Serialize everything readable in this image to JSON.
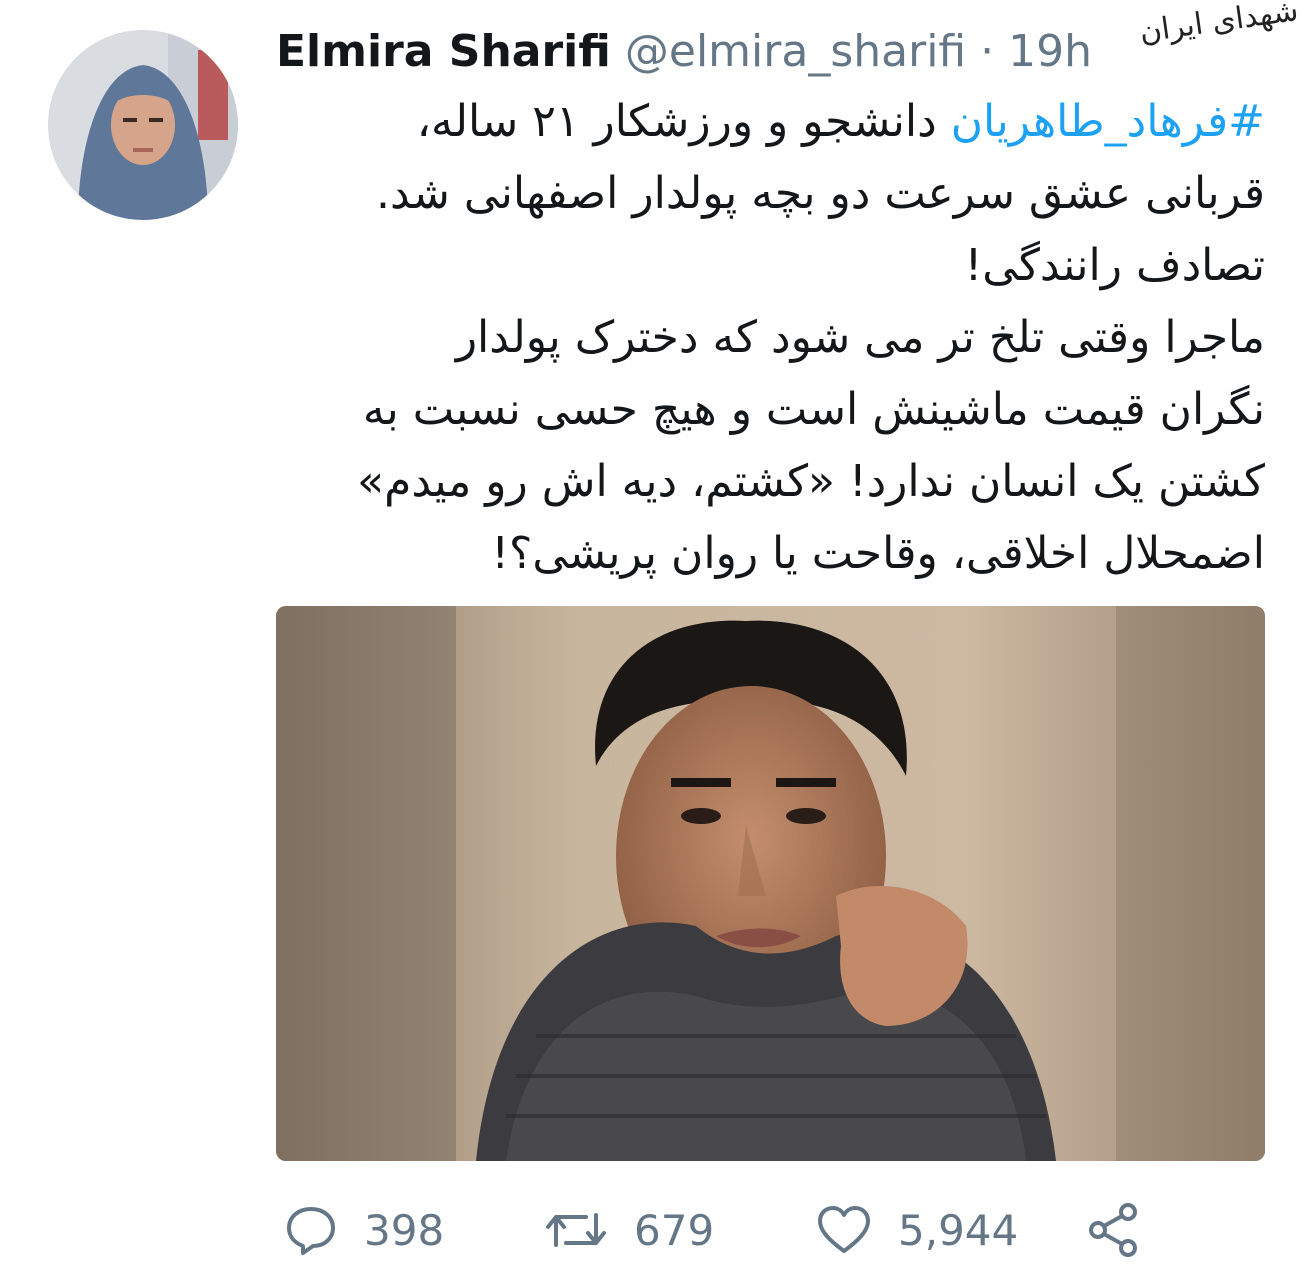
{
  "tweet": {
    "author_name": "Elmira Sharifi",
    "author_handle": "@elmira_sharifi",
    "separator": "·",
    "time": "19h",
    "hashtag": "#فرهاد_طاهریان",
    "lines": [
      " دانشجو و ورزشکار ۲۱ ساله،",
      "قربانی عشق سرعت دو بچه پولدار اصفهانی شد.",
      "تصادف رانندگی!",
      "ماجرا وقتی تلخ تر می شود که دخترک پولدار",
      "نگران قیمت ماشینش است و هیچ حسی نسبت به",
      "کشتن یک انسان ندارد! «کشتم، دیه اش رو میدم»",
      "اضمحلال اخلاقی، وقاحت یا روان پریشی؟!"
    ]
  },
  "watermark": "شهدای ایران",
  "actions": {
    "reply": {
      "icon": "reply-icon",
      "count": "398"
    },
    "retweet": {
      "icon": "retweet-icon",
      "count": "679"
    },
    "like": {
      "icon": "heart-icon",
      "count": "5,944"
    },
    "share": {
      "icon": "share-icon"
    }
  },
  "colors": {
    "hashtag": "#1da1f2",
    "muted": "#657786",
    "text": "#14171a"
  }
}
